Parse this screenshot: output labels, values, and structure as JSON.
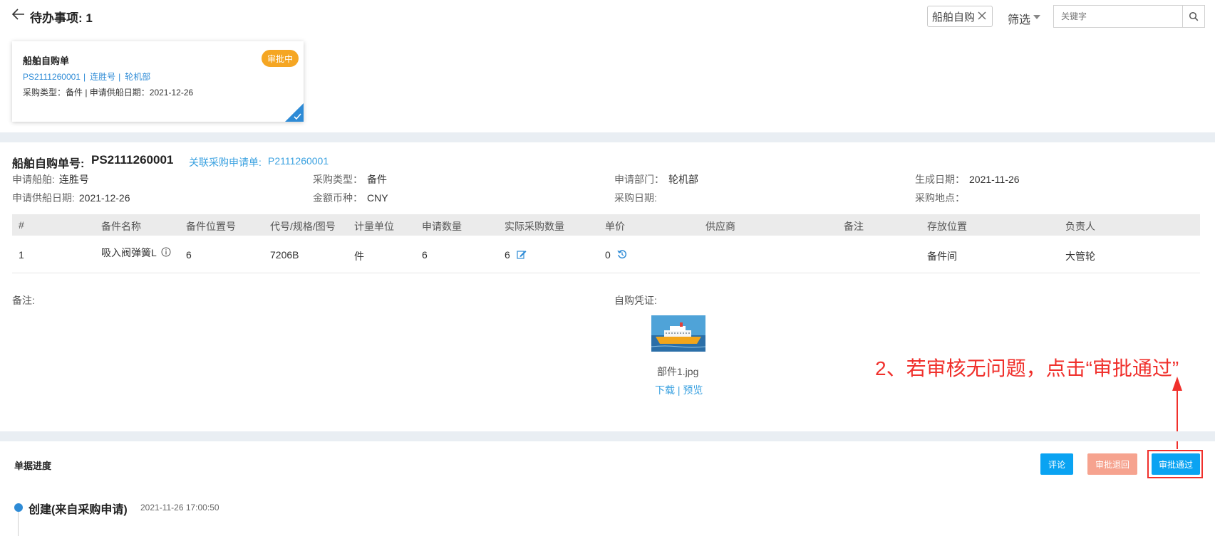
{
  "header": {
    "title": "待办事项: 1",
    "filter_tag": "船舶自购",
    "filter_button": "筛选",
    "search_placeholder": "关键字"
  },
  "card": {
    "title": "船舶自购单",
    "badge": "审批中",
    "order_no": "PS2111260001",
    "ship": "连胜号",
    "department": "轮机部",
    "info": "采购类型：备件 | 申请供船日期：2021-12-26"
  },
  "detail": {
    "order_no_label": "船舶自购单号:",
    "order_no": "PS2111260001",
    "related_label": "关联采购申请单:",
    "related_no": "P2111260001",
    "fields": [
      {
        "label": "申请船舶:",
        "value": "连胜号"
      },
      {
        "label": "采购类型：",
        "value": "备件"
      },
      {
        "label": "申请部门：",
        "value": "轮机部"
      },
      {
        "label": "生成日期：",
        "value": "2021-11-26"
      },
      {
        "label": "申请供船日期:",
        "value": "2021-12-26"
      },
      {
        "label": "金额币种：",
        "value": "CNY"
      },
      {
        "label": "采购日期:",
        "value": ""
      },
      {
        "label": "采购地点：",
        "value": ""
      }
    ]
  },
  "table": {
    "headers": [
      "#",
      "备件名称",
      "备件位置号",
      "代号/规格/图号",
      "计量单位",
      "申请数量",
      "实际采购数量",
      "单价",
      "供应商",
      "备注",
      "存放位置",
      "负责人"
    ],
    "rows": [
      {
        "index": "1",
        "name": "吸入阀弹簧L",
        "position_no": "6",
        "code": "7206B",
        "unit": "件",
        "apply_qty": "6",
        "actual_qty": "6",
        "price": "0",
        "supplier": "",
        "remark": "",
        "storage": "备件间",
        "owner": "大管轮"
      }
    ]
  },
  "remark_label": "备注:",
  "voucher": {
    "label": "自购凭证:",
    "file_name": "部件1.jpg",
    "download": "下载",
    "separator": "|",
    "preview": "预览"
  },
  "annotation": "2、若审核无问题，点击“审批通过”",
  "progress": {
    "title": "单据进度",
    "comment_button": "评论",
    "return_button": "审批退回",
    "approve_button": "审批通过",
    "timeline": [
      {
        "title": "创建(来自采购申请)",
        "time": "2021-11-26 17:00:50"
      }
    ]
  },
  "colors": {
    "primary": "#0aa3f2",
    "link": "#3aa1e0",
    "badge": "#f5a623",
    "return": "#f6a38f",
    "annotation": "#f0302c"
  }
}
